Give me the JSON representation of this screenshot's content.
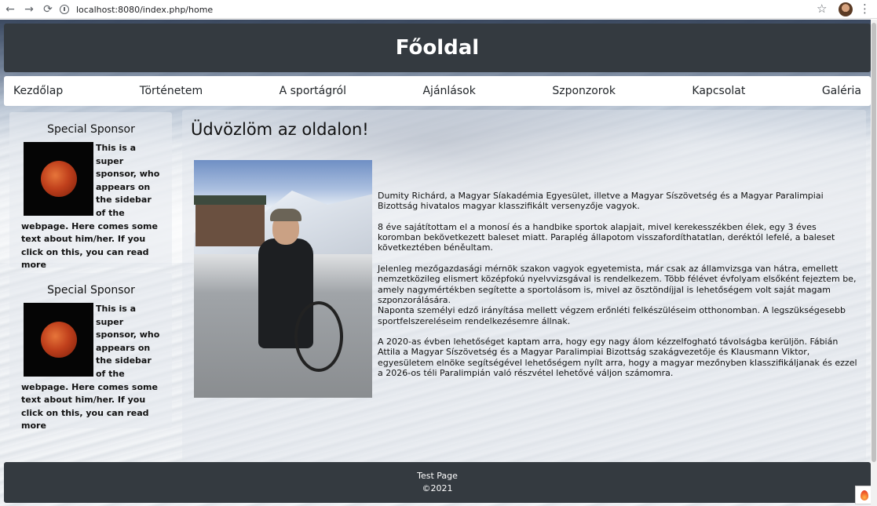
{
  "browser": {
    "url": "localhost:8080/index.php/home",
    "back_icon": "←",
    "forward_icon": "→",
    "reload_icon": "⟳",
    "star_icon": "☆",
    "menu_icon": "⋮"
  },
  "header": {
    "title": "Főoldal"
  },
  "nav": {
    "items": [
      {
        "label": "Kezdőlap"
      },
      {
        "label": "Történetem"
      },
      {
        "label": "A sportágról"
      },
      {
        "label": "Ajánlások"
      },
      {
        "label": "Szponzorok"
      },
      {
        "label": "Kapcsolat"
      },
      {
        "label": "Galéria"
      }
    ]
  },
  "sidebar": {
    "sponsors": [
      {
        "title": "Special Sponsor",
        "text": "This is a super sponsor, who appears on the sidebar of the webpage. Here comes some text about him/her. If you click on this, you can read more"
      },
      {
        "title": "Special Sponsor",
        "text": "This is a super sponsor, who appears on the sidebar of the webpage. Here comes some text about him/her. If you click on this, you can read more"
      }
    ]
  },
  "main": {
    "heading": "Üdvözlöm az oldalon!",
    "paragraphs": [
      "Dumity Richárd, a Magyar Síakadémia Egyesület, illetve a Magyar Síszövetség és a Magyar Paralimpiai Bizottság hivatalos magyar klasszifikált versenyzője vagyok.",
      "8 éve sajátítottam el a monosí és a handbike sportok alapjait, mivel kerekesszékben élek, egy 3 éves koromban bekövetkezett baleset miatt. Paraplég állapotom visszafordíthatatlan, deréktól lefelé, a baleset következtében béněultam.",
      "Jelenleg mezőgazdasági mérnök szakon vagyok egyetemista, már csak az államvizsga van hátra, emellett nemzetközileg elismert középfokú nyelvvizsgával is rendelkezem. Több félévet évfolyam elsőként fejeztem be, amely nagymértékben segítette a sportolásom is, mivel az ösztöndíjjal is lehetőségem volt saját magam szponzorálására.",
      "Naponta személyi edző irányítása mellett végzem erőnléti felkészüléseim otthonomban. A legszükségesebb sportfelszereléseim rendelkezésemre állnak.",
      "A 2020-as évben lehetőséget kaptam arra, hogy egy nagy álom kézzelfogható távolságba kerüljön. Fábián Attila a Magyar Síszövetség és a Magyar Paralimpiai Bizottság szakágvezetője és Klausmann Viktor, egyesületem elnöke segítségével lehetőségem nyílt arra, hogy a magyar mezőnyben klasszifikáljanak és ezzel a 2026-os téli Paralimpián való részvétel lehetővé váljon számomra."
    ]
  },
  "footer": {
    "line1": "Test Page",
    "line2": "©2021"
  }
}
